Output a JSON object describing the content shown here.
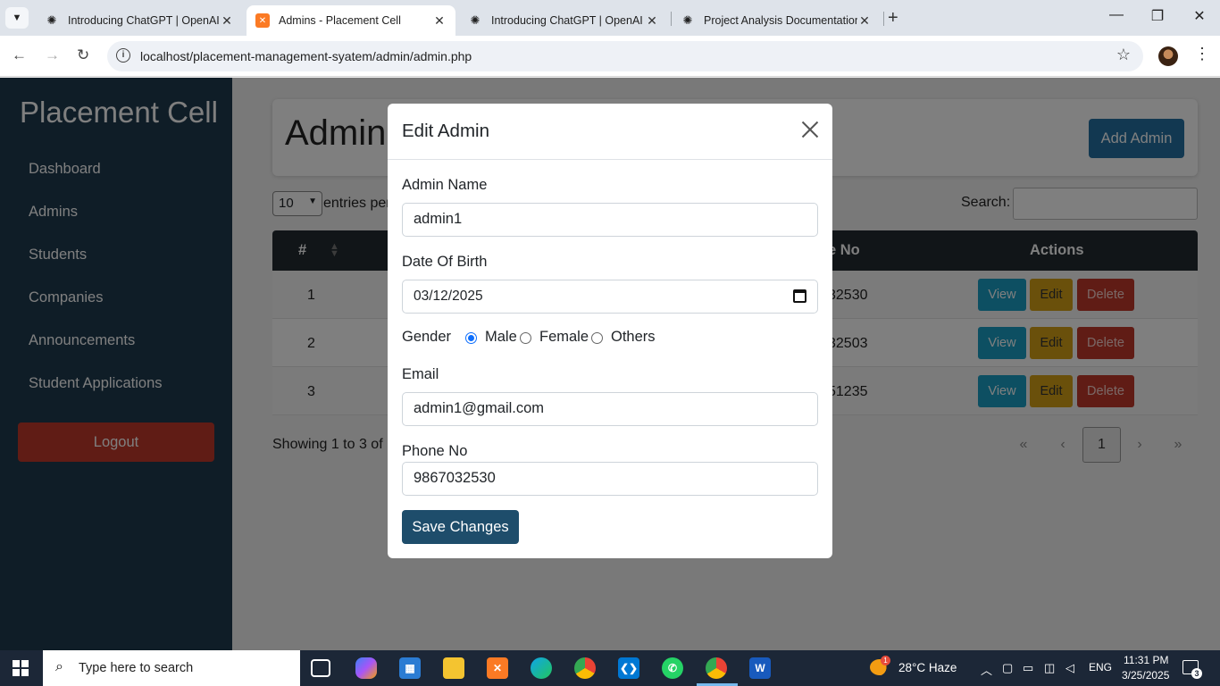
{
  "browser": {
    "tabs": [
      {
        "title": "Introducing ChatGPT | OpenAI",
        "icon": "openai-icon",
        "active": false
      },
      {
        "title": "Admins - Placement Cell",
        "icon": "xampp-icon",
        "active": true
      },
      {
        "title": "Introducing ChatGPT | OpenAI",
        "icon": "openai-icon",
        "active": false
      },
      {
        "title": "Project Analysis Documentation",
        "icon": "openai-icon",
        "active": false
      }
    ],
    "url": "localhost/placement-management-syatem/admin/admin.php"
  },
  "sidebar": {
    "brand": "Placement Cell",
    "items": [
      {
        "label": "Dashboard"
      },
      {
        "label": "Admins"
      },
      {
        "label": "Students"
      },
      {
        "label": "Companies"
      },
      {
        "label": "Announcements"
      },
      {
        "label": "Student Applications"
      }
    ],
    "logout": "Logout"
  },
  "page": {
    "title": "Admin",
    "add_button": "Add Admin",
    "entries_value": "10",
    "entries_text": "entries per",
    "search_label": "Search:",
    "table": {
      "headers": {
        "num": "#",
        "phone": "e No",
        "actions": "Actions"
      },
      "rows": [
        {
          "num": "1",
          "phone": "32530"
        },
        {
          "num": "2",
          "phone": "32503"
        },
        {
          "num": "3",
          "phone": "51235"
        }
      ],
      "action_labels": {
        "view": "View",
        "edit": "Edit",
        "delete": "Delete"
      }
    },
    "showing": "Showing 1 to 3 of",
    "pagination": {
      "first": "«",
      "prev": "‹",
      "current": "1",
      "next": "›",
      "last": "»"
    }
  },
  "modal": {
    "title": "Edit Admin",
    "fields": {
      "name_label": "Admin Name",
      "name_value": "admin1",
      "dob_label": "Date Of Birth",
      "dob_value": "03/12/2025",
      "gender_label": "Gender",
      "gender_options": [
        "Male",
        "Female",
        "Others"
      ],
      "gender_selected": "Male",
      "email_label": "Email",
      "email_value": "admin1@gmail.com",
      "phone_label": "Phone No",
      "phone_value": "9867032530"
    },
    "save_label": "Save Changes"
  },
  "taskbar": {
    "search_placeholder": "Type here to search",
    "weather": "28°C  Haze",
    "weather_badge": "1",
    "lang": "ENG",
    "time": "11:31 PM",
    "date": "3/25/2025",
    "notification_count": "3"
  }
}
